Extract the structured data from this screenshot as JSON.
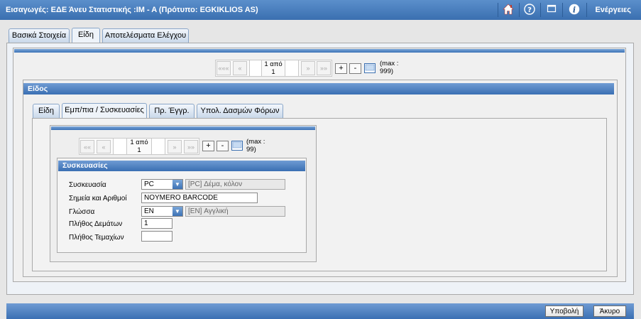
{
  "header": {
    "title": "Εισαγωγές: ΕΔΕ Άνευ Στατιστικής :IM - A      (Πρότυπο: EGKIKLIOS AS)",
    "actions_label": "Ενέργειες",
    "icons": [
      "home-icon",
      "help-icon",
      "window-icon",
      "info-icon"
    ]
  },
  "main_tabs": [
    {
      "label": "Βασικά Στοιχεία"
    },
    {
      "label": "Είδη"
    },
    {
      "label": "Αποτελέσματα Ελέγχου"
    }
  ],
  "outer_nav": {
    "first": "«««",
    "prev": "«",
    "page": "1 από 1",
    "next": "»",
    "last": "»»",
    "plus": "+",
    "minus": "-",
    "max": "(max : 999)"
  },
  "item_section": {
    "title": "Είδος"
  },
  "sub_tabs": [
    {
      "label": "Είδη"
    },
    {
      "label": "Εμπ/πια / Συσκευασίες"
    },
    {
      "label": "Πρ. Έγγρ."
    },
    {
      "label": "Υπολ. Δασμών Φόρων"
    }
  ],
  "inner_nav": {
    "first": "««",
    "prev": "«",
    "page": "1 από 1",
    "next": "»",
    "last": "»»",
    "plus": "+",
    "minus": "-",
    "max": "(max : 99)"
  },
  "packaging": {
    "title": "Συσκευασίες",
    "fields": {
      "package_label": "Συσκευασία",
      "package_code": "PC",
      "package_desc": "[PC] Δέμα, κόλον",
      "marks_label": "Σημεία και Αριθμοί",
      "marks_value": "NOYMERO BARCODE",
      "language_label": "Γλώσσα",
      "language_code": "EN",
      "language_desc": "[EN] Αγγλική",
      "bundles_label": "Πλήθος Δεμάτων",
      "bundles_value": "1",
      "pieces_label": "Πλήθος Τεμαχίων",
      "pieces_value": ""
    }
  },
  "footer": {
    "submit_label": "Υποβολή",
    "cancel_label": "Άκυρο"
  },
  "colors": {
    "accent": "#3a6fb0",
    "panel": "#f0f0f0"
  }
}
